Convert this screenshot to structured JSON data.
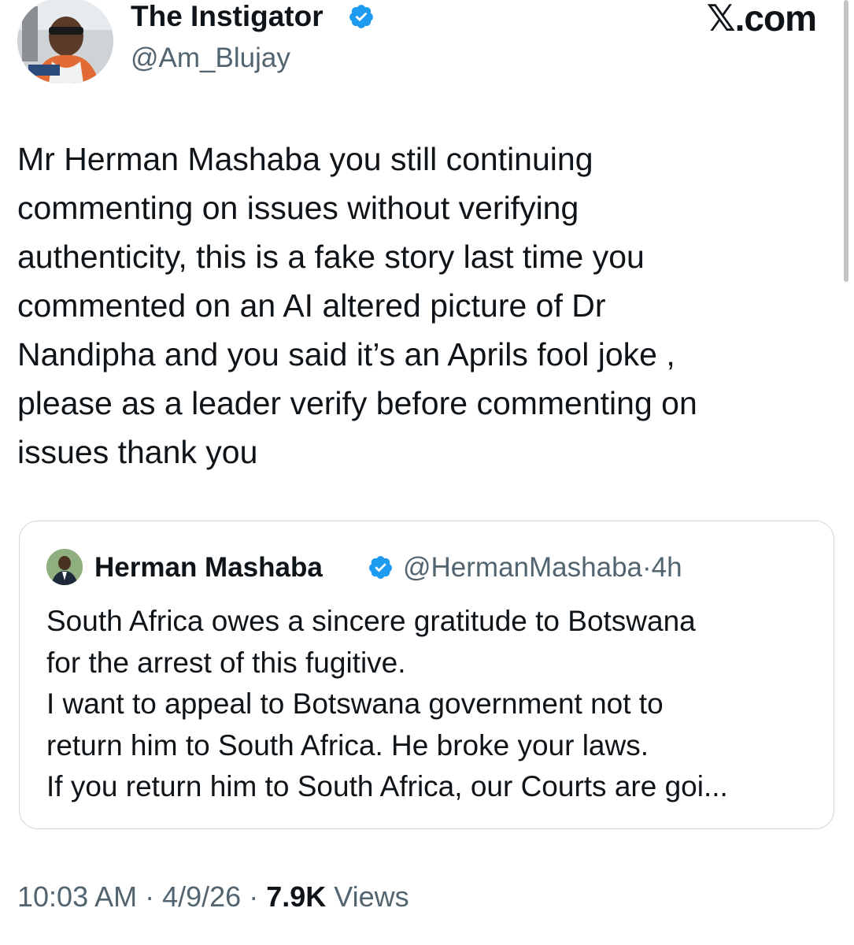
{
  "brand": {
    "site_label": "𝕏.com"
  },
  "tweet": {
    "author": {
      "display_name": "The Instigator",
      "handle": "@Am_Blujay",
      "verified": true,
      "avatar_icon": "profile-photo"
    },
    "text": "Mr Herman Mashaba you still continuing\ncommenting on issues without verifying\nauthenticity, this is a fake story last time you\ncommented on an AI altered picture of Dr\nNandipha and you said it’s an Aprils fool joke ,\nplease as a leader verify before commenting on\nissues thank you",
    "time": "10:03 AM",
    "date": "4/9/26",
    "views_count": "7.9K",
    "views_label": "Views",
    "separator": " · "
  },
  "quoted_tweet": {
    "author": {
      "display_name": "Herman Mashaba",
      "handle": "@HermanMashaba",
      "verified": true,
      "avatar_icon": "profile-photo"
    },
    "age": "4h",
    "separator": "·",
    "text": "South Africa owes a sincere gratitude to Botswana\nfor the arrest of this fugitive.\nI want to appeal to Botswana government not to\nreturn him to South Africa. He broke your laws.\nIf you return him to South Africa, our Courts are goi..."
  },
  "colors": {
    "text_primary": "#0f1419",
    "text_secondary": "#536471",
    "verified_blue": "#1d9bf0",
    "border": "#cfd9de",
    "background": "#ffffff"
  }
}
